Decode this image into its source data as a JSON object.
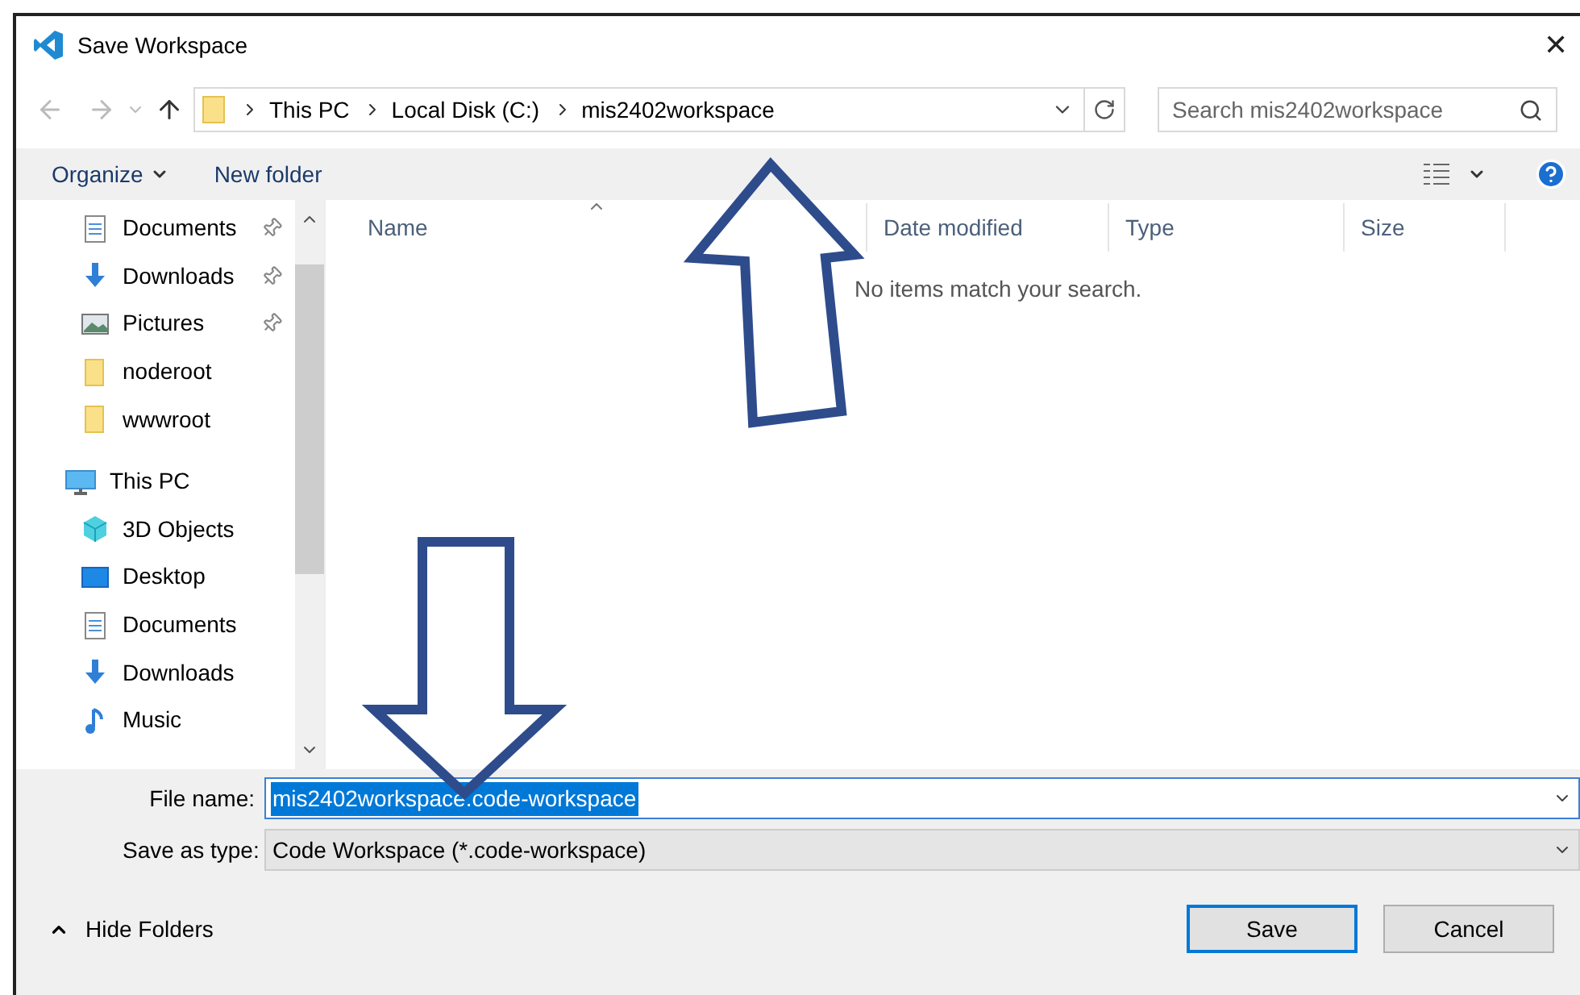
{
  "window": {
    "title": "Save Workspace",
    "close": "✕"
  },
  "address_bar": {
    "breadcrumbs": [
      "This PC",
      "Local Disk (C:)",
      "mis2402workspace"
    ],
    "search_placeholder": "Search mis2402workspace"
  },
  "toolbar": {
    "items": [
      {
        "label": "Organize",
        "dropdown": true
      },
      {
        "label": "New folder",
        "dropdown": false
      }
    ]
  },
  "nav_pane": {
    "items": [
      {
        "label": "Documents",
        "kind": "documents",
        "pinned": true
      },
      {
        "label": "Downloads",
        "kind": "downloads",
        "pinned": true
      },
      {
        "label": "Pictures",
        "kind": "pictures",
        "pinned": true
      },
      {
        "label": "noderoot",
        "kind": "folder",
        "pinned": false
      },
      {
        "label": "wwwroot",
        "kind": "folder",
        "pinned": false
      },
      {
        "label": "This PC",
        "kind": "pc",
        "pinned": false,
        "children": [
          {
            "label": "3D Objects",
            "kind": "cube",
            "pinned": false
          },
          {
            "label": "Desktop",
            "kind": "desktop",
            "pinned": false
          },
          {
            "label": "Documents",
            "kind": "documents",
            "pinned": false
          },
          {
            "label": "Downloads",
            "kind": "downloads",
            "pinned": false
          },
          {
            "label": "Music",
            "kind": "music",
            "pinned": false
          }
        ]
      }
    ]
  },
  "file_list": {
    "columns": [
      {
        "label": "Name",
        "sorted": true
      },
      {
        "label": "Date modified",
        "sorted": false
      },
      {
        "label": "Type",
        "sorted": false
      },
      {
        "label": "Size",
        "sorted": false
      }
    ],
    "empty_message": "No items match your search."
  },
  "form": {
    "file_name_label": "File name:",
    "file_name": "mis2402workspace.code-workspace",
    "file_name_selected": true,
    "type_label": "Save as type:",
    "type_value": "Code Workspace (*.code-workspace)"
  },
  "footer": {
    "hide_folders": "Hide Folders",
    "buttons": [
      {
        "label": "Save",
        "default": true
      },
      {
        "label": "Cancel",
        "default": false
      }
    ]
  }
}
